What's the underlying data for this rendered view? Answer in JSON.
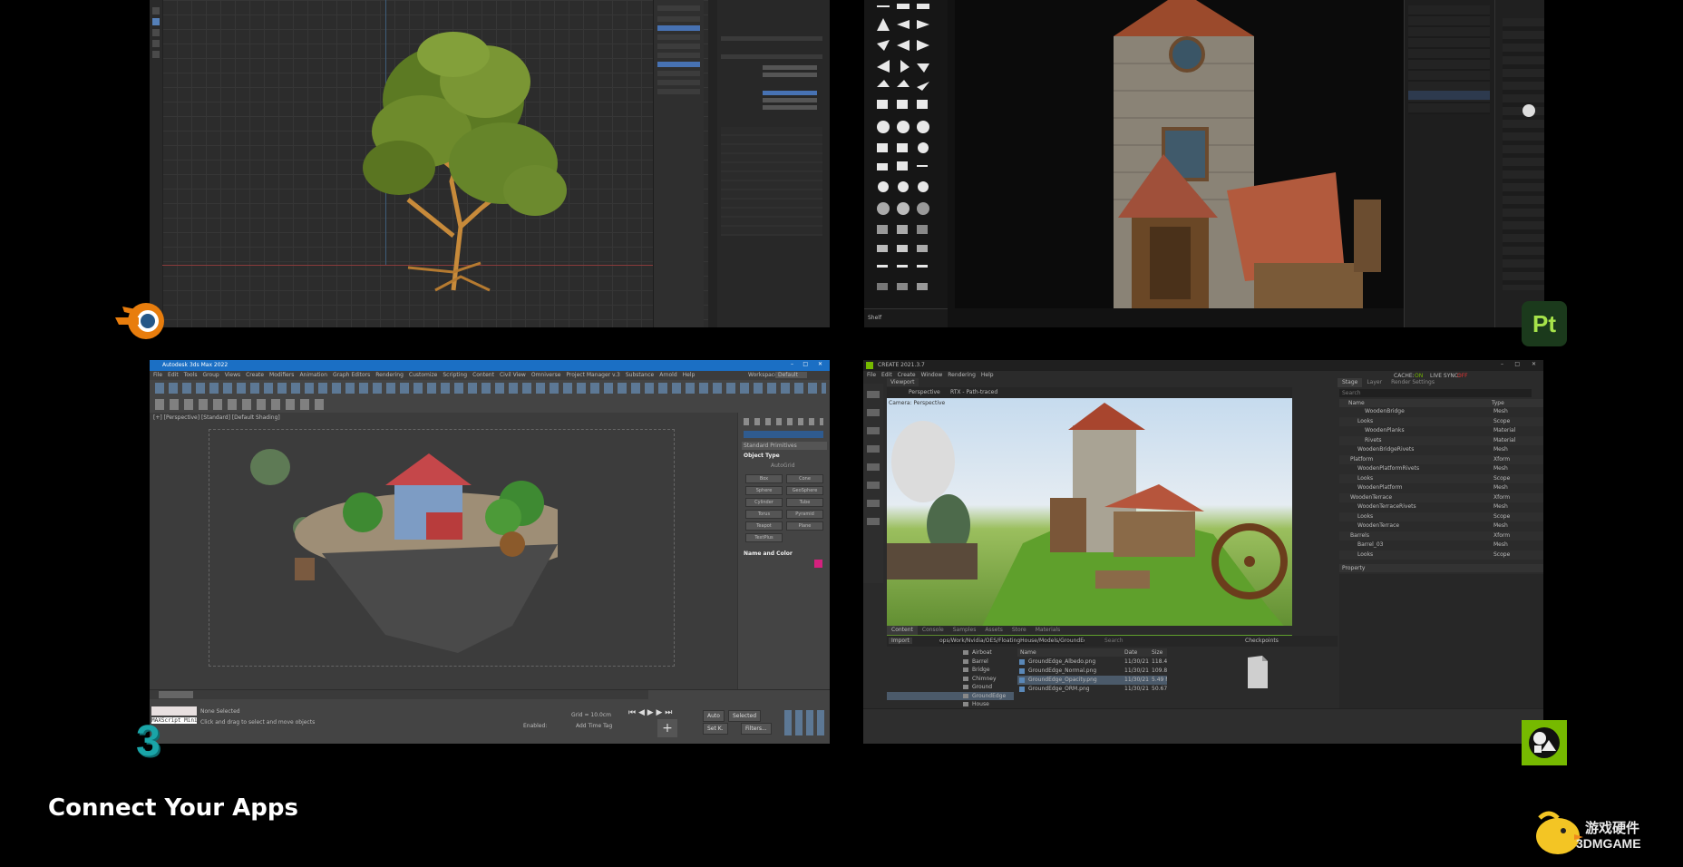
{
  "caption": "Connect Your Apps",
  "watermark": {
    "cn": "游戏硬件",
    "en": "3DMGAME"
  },
  "logos": {
    "blender": "blender-logo",
    "painter": "Pt",
    "max": "3",
    "omniverse": "omniverse-create-logo"
  },
  "colors": {
    "painter_bg": "#1b3a1c",
    "painter_fg": "#a6e34a",
    "max_teal": "#1aa5a8",
    "blender_orange": "#e87d0d",
    "omni_green": "#76b900",
    "max_titlebar": "#1b6fc4"
  },
  "max": {
    "title": "Autodesk 3ds Max 2022",
    "menu": [
      "File",
      "Edit",
      "Tools",
      "Group",
      "Views",
      "Create",
      "Modifiers",
      "Animation",
      "Graph Editors",
      "Rendering",
      "Customize",
      "Scripting",
      "Content",
      "Civil View",
      "Omniverse",
      "Project Manager v.3",
      "Substance",
      "Arnold",
      "Help"
    ],
    "workspaces": "Workspaces:",
    "workspace_value": "Default",
    "viewport_label": "[+] [Perspective] [Standard] [Default Shading]",
    "panel": {
      "dropdown": "Standard Primitives",
      "object_type": "Object Type",
      "autogrid": "AutoGrid",
      "buttons": [
        "Box",
        "Cone",
        "Sphere",
        "GeoSphere",
        "Cylinder",
        "Tube",
        "Torus",
        "Pyramid",
        "Teapot",
        "Plane",
        "TextPlus"
      ],
      "name_color": "Name and Color"
    },
    "status": {
      "none_selected": "None Selected",
      "hint": "Click and drag to select and move objects",
      "maxscript": "MAXScript Mini",
      "grid": "Grid = 10.0cm",
      "enabled": "Enabled:",
      "add_time_tag": "Add Time Tag",
      "auto": "Auto",
      "set_k": "Set K.",
      "selected": "Selected",
      "filters": "Filters..."
    }
  },
  "omni": {
    "title": "CREATE  2021.3.7",
    "cache": "CACHE:",
    "cache_value": "ON",
    "live_sync": "LIVE SYNC:",
    "live_sync_value": "OFF",
    "menu": [
      "File",
      "Edit",
      "Create",
      "Window",
      "Rendering",
      "Help"
    ],
    "viewport_tab": "Viewport",
    "viewport_toolbar": [
      "Perspective",
      "RTX - Path-traced"
    ],
    "camera_label": "Camera: Perspective",
    "stage_tabs": [
      "Stage",
      "Layer",
      "Render Settings"
    ],
    "search_placeholder": "Search",
    "stage_headers": [
      "Name",
      "Type"
    ],
    "stage_rows": [
      {
        "name": "WoodenBridge",
        "type": "Mesh"
      },
      {
        "name": "Looks",
        "type": "Scope"
      },
      {
        "name": "WoodenPlanks",
        "type": "Material"
      },
      {
        "name": "Rivets",
        "type": "Material"
      },
      {
        "name": "WoodenBridgeRivets",
        "type": "Mesh"
      },
      {
        "name": "Platform",
        "type": "Xform"
      },
      {
        "name": "WoodenPlatformRivets",
        "type": "Mesh"
      },
      {
        "name": "Looks",
        "type": "Scope"
      },
      {
        "name": "WoodenPlatform",
        "type": "Mesh"
      },
      {
        "name": "WoodenTerrace",
        "type": "Xform"
      },
      {
        "name": "WoodenTerraceRivets",
        "type": "Mesh"
      },
      {
        "name": "Looks",
        "type": "Scope"
      },
      {
        "name": "WoodenTerrace",
        "type": "Mesh"
      },
      {
        "name": "Barrels",
        "type": "Xform"
      },
      {
        "name": "Barrel_03",
        "type": "Mesh"
      },
      {
        "name": "Looks",
        "type": "Scope"
      }
    ],
    "property_tab": "Property",
    "content_tabs": [
      "Content",
      "Console",
      "Samples",
      "Assets",
      "Store",
      "Materials"
    ],
    "import": "Import",
    "path": "ops/Work/Nvidia/OES/FloatingHouse/Models/GroundEdge/",
    "search_placeholder2": "Search",
    "folders": [
      "Airboat",
      "Barrel",
      "Bridge",
      "Chimney",
      "Ground",
      "GroundEdge",
      "House"
    ],
    "file_headers": [
      "Name",
      "Date",
      "Size"
    ],
    "files": [
      {
        "name": "GroundEdge_Albedo.png",
        "date": "11/30/21 11:16 AM",
        "size": "118.46"
      },
      {
        "name": "GroundEdge_Normal.png",
        "date": "11/30/21 11:16 AM",
        "size": "109.83"
      },
      {
        "name": "GroundEdge_Opacity.png",
        "date": "11/30/21 11:16 AM",
        "size": "5.49 M"
      },
      {
        "name": "GroundEdge_ORM.png",
        "date": "11/30/21 11:16 AM",
        "size": "50.67 M"
      }
    ],
    "checkpoints": "Checkpoints"
  },
  "painter": {
    "bottom_label": "Shelf"
  }
}
